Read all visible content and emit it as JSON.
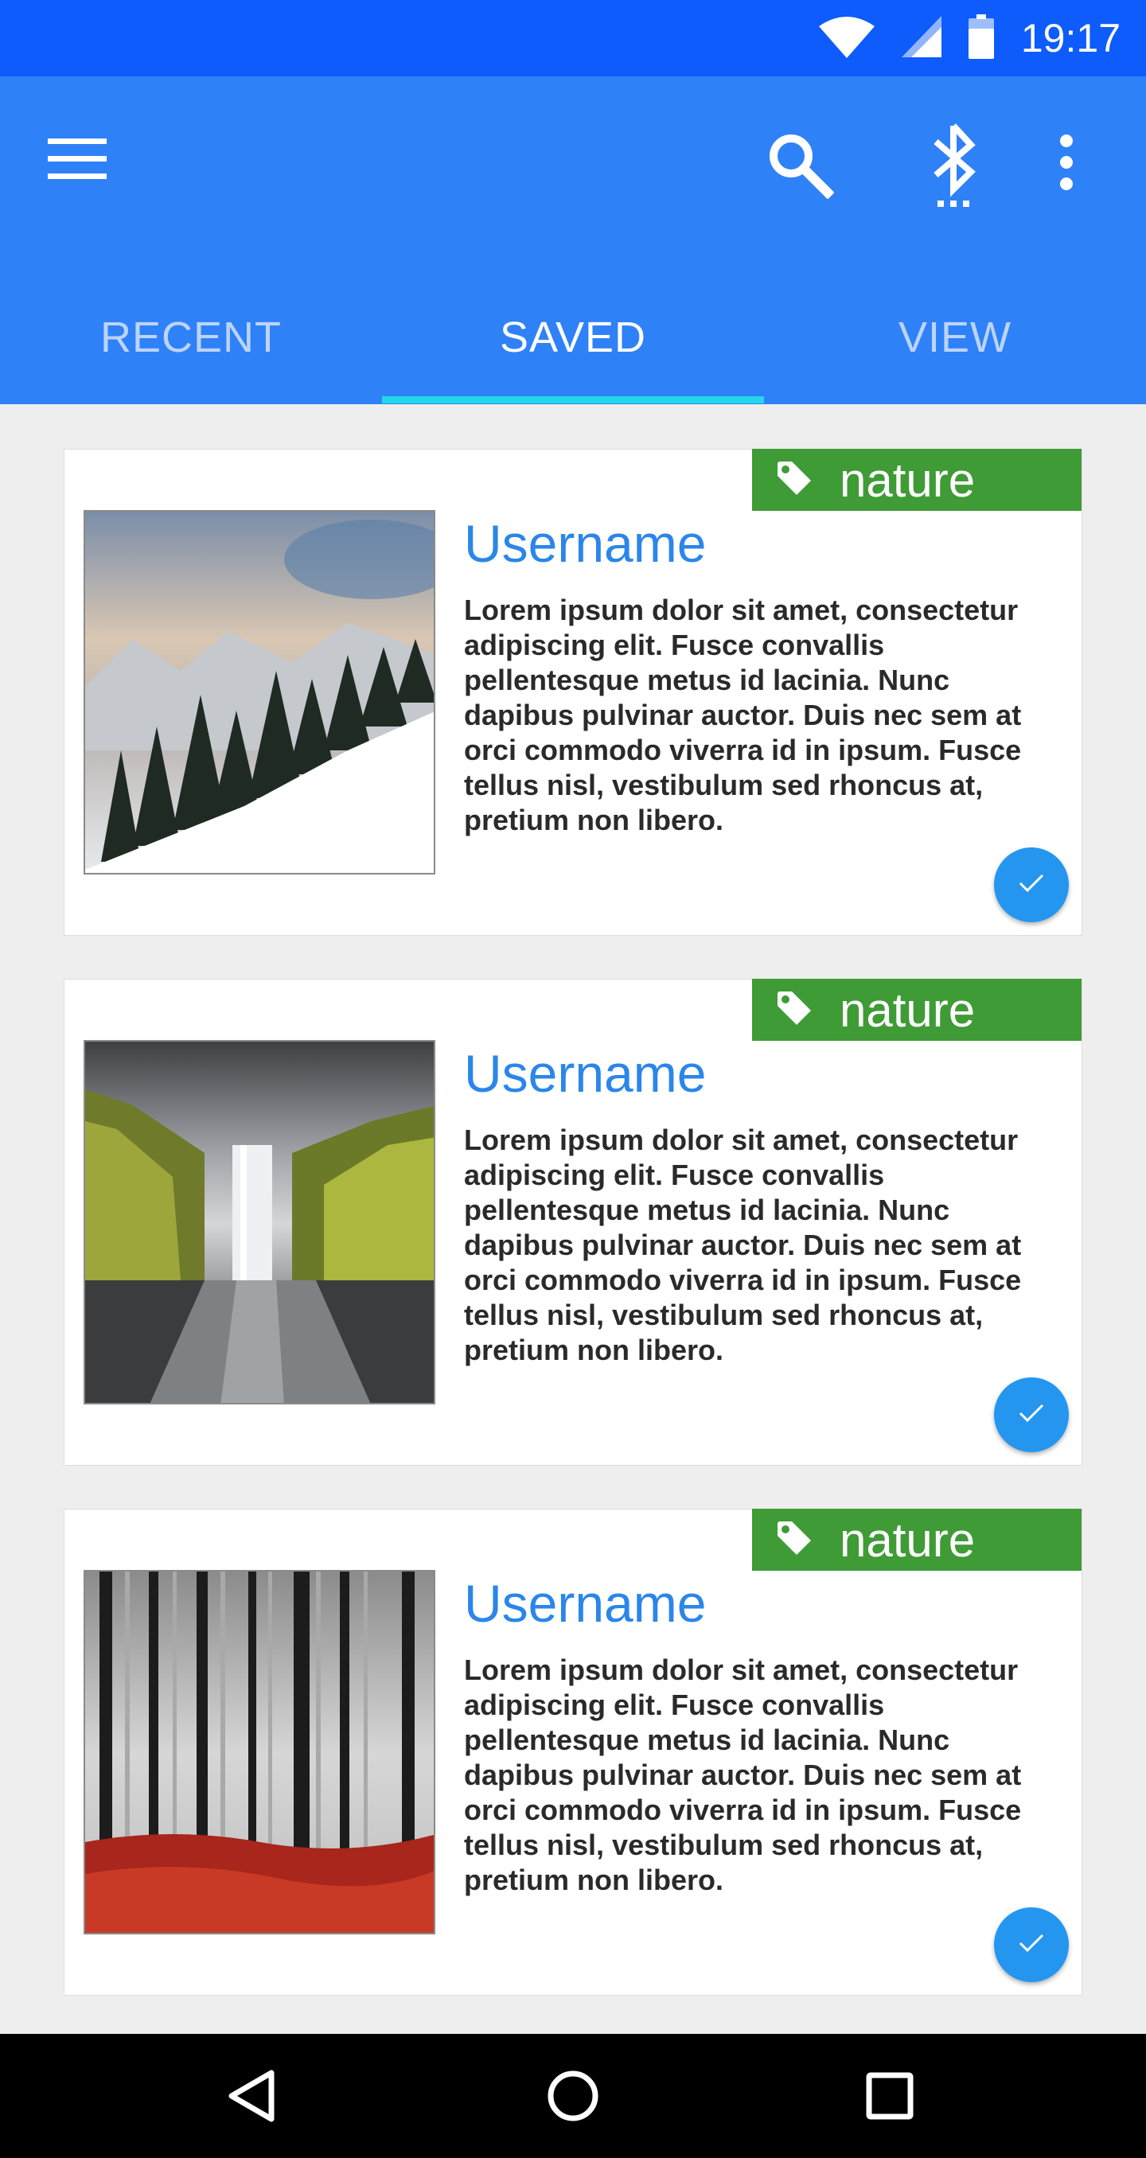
{
  "status_bar": {
    "time": "19:17",
    "icons": [
      "wifi-icon",
      "signal-icon",
      "battery-icon"
    ],
    "background": "#0d5cfb"
  },
  "app_bar": {
    "background": "#2f81f7",
    "actions": [
      "menu-icon",
      "search-icon",
      "bluetooth-searching-icon",
      "more-vert-icon"
    ]
  },
  "tabs": [
    {
      "label": "RECENT",
      "active": false
    },
    {
      "label": "SAVED",
      "active": true
    },
    {
      "label": "VIEW",
      "active": false
    }
  ],
  "tab_indicator_color": "#22d8ea",
  "cards": [
    {
      "tag": "nature",
      "username": "Username",
      "body": "Lorem ipsum dolor sit amet, consectetur adipiscing elit. Fusce convallis pellentesque metus id lacinia. Nunc dapibus pulvinar auctor. Duis nec sem at orci commodo viverra id in ipsum. Fusce tellus nisl, vestibulum sed rhoncus at, pretium non libero.",
      "image": "snowy-mountain-forest",
      "checked": true
    },
    {
      "tag": "nature",
      "username": "Username",
      "body": "Lorem ipsum dolor sit amet, consectetur adipiscing elit. Fusce convallis pellentesque metus id lacinia. Nunc dapibus pulvinar auctor. Duis nec sem at orci commodo viverra id in ipsum. Fusce tellus nisl, vestibulum sed rhoncus at, pretium non libero.",
      "image": "waterfall-cliffs",
      "checked": true
    },
    {
      "tag": "nature",
      "username": "Username",
      "body": "Lorem ipsum dolor sit amet, consectetur adipiscing elit. Fusce convallis pellentesque metus id lacinia. Nunc dapibus pulvinar auctor. Duis nec sem at orci commodo viverra id in ipsum. Fusce tellus nisl, vestibulum sed rhoncus at, pretium non libero.",
      "image": "misty-forest-red-ferns",
      "checked": true
    }
  ],
  "colors": {
    "tag": "#3f9b35",
    "username": "#2b86ea",
    "fab": "#2496f0"
  },
  "nav_bar": {
    "buttons": [
      "back-icon",
      "home-icon",
      "recents-icon"
    ]
  }
}
